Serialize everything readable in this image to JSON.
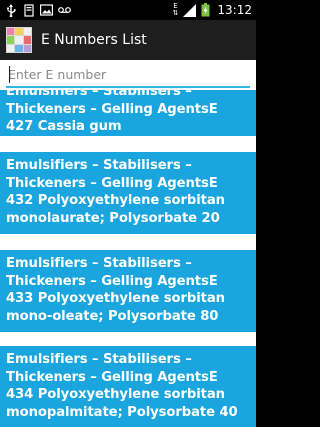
{
  "status_bar": {
    "time": "13:12",
    "battery_percent": "73",
    "network_label": "E",
    "left_icons": [
      "usb-icon",
      "debug-icon",
      "image-icon",
      "voicemail-icon"
    ]
  },
  "action_bar": {
    "title": "E Numbers List"
  },
  "search": {
    "placeholder": "Enter E number",
    "value": ""
  },
  "list": {
    "items": [
      {
        "lines": [
          "Emulsifiers – Stabilisers –",
          "Thickeners – Gelling AgentsE",
          "427 Cassia gum"
        ]
      },
      {
        "lines": [
          "Emulsifiers – Stabilisers –",
          "Thickeners – Gelling AgentsE",
          "432 Polyoxyethylene sorbitan",
          "monolaurate; Polysorbate 20"
        ]
      },
      {
        "lines": [
          "Emulsifiers – Stabilisers –",
          "Thickeners – Gelling AgentsE",
          "433 Polyoxyethylene sorbitan",
          "mono-oleate; Polysorbate 80"
        ]
      },
      {
        "lines": [
          "Emulsifiers – Stabilisers –",
          "Thickeners – Gelling AgentsE",
          "434 Polyoxyethylene sorbitan",
          "monopalmitate; Polysorbate 40"
        ]
      }
    ]
  },
  "colors": {
    "item_background": "#1aa5df",
    "accent": "#33b5e5",
    "action_bar": "#1e1e1e"
  }
}
